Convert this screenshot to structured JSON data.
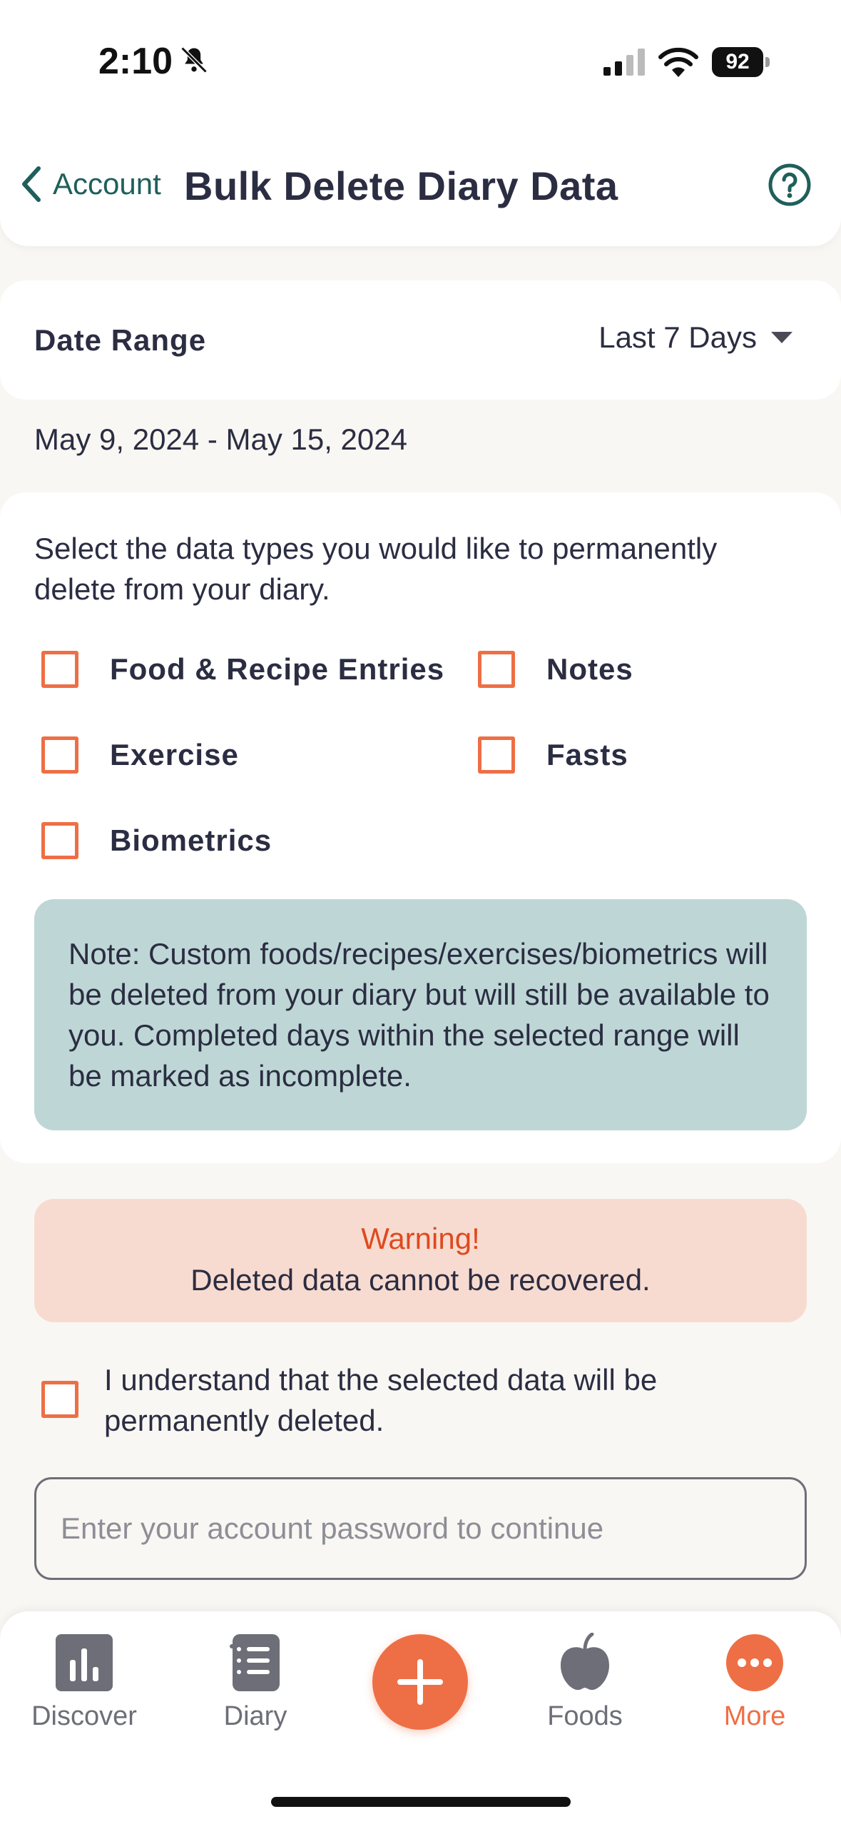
{
  "status_bar": {
    "time": "2:10",
    "battery": "92"
  },
  "header": {
    "back_label": "Account",
    "title": "Bulk Delete Diary Data"
  },
  "date_range": {
    "label": "Date Range",
    "selected": "Last 7 Days",
    "span": "May 9, 2024 - May 15, 2024"
  },
  "data_types": {
    "intro": "Select the data types you would like to permanently delete from your diary.",
    "options": [
      "Food & Recipe Entries",
      "Notes",
      "Exercise",
      "Fasts",
      "Biometrics"
    ],
    "note": "Note: Custom foods/recipes/exercises/biometrics will be deleted from your diary but will still be available to you. Completed days within the selected range will be marked as incomplete."
  },
  "warning": {
    "title": "Warning!",
    "text": "Deleted data cannot be recovered."
  },
  "confirm": {
    "text": "I understand that the selected data will be permanently deleted."
  },
  "password": {
    "placeholder": "Enter your account password to continue"
  },
  "tab_bar": {
    "discover": "Discover",
    "diary": "Diary",
    "foods": "Foods",
    "more": "More"
  },
  "colors": {
    "accent": "#ee6f45",
    "teal": "#1f5f5b",
    "note_bg": "#bed7d6",
    "warning_bg": "#f8dbd0",
    "warning_text": "#de4a1f"
  }
}
